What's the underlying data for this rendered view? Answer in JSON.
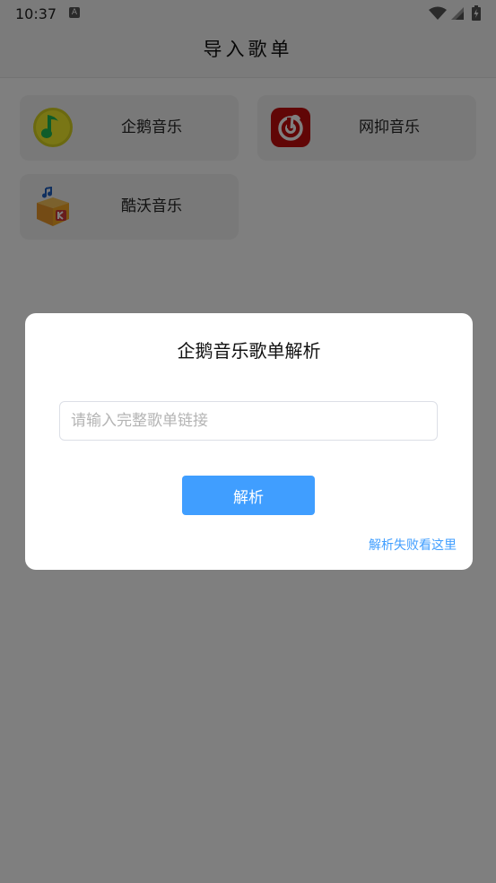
{
  "status_bar": {
    "time": "10:37",
    "app_badge": "A",
    "icons": [
      "wifi-icon",
      "signal-icon",
      "battery-icon"
    ]
  },
  "header": {
    "title": "导入歌单"
  },
  "sources": [
    {
      "label": "企鹅音乐",
      "icon": "qq-music-icon",
      "color": "#31c27c"
    },
    {
      "label": "网抑音乐",
      "icon": "netease-music-icon",
      "color": "#c20c0c"
    },
    {
      "label": "酷沃音乐",
      "icon": "kuwo-music-icon",
      "color": "#f5a623"
    }
  ],
  "dialog": {
    "title": "企鹅音乐歌单解析",
    "input_placeholder": "请输入完整歌单链接",
    "input_value": "",
    "parse_label": "解析",
    "help_link": "解析失败看这里"
  },
  "colors": {
    "accent": "#409eff",
    "card_bg": "#f2f2f2",
    "overlay": "rgba(0,0,0,0.5)"
  }
}
